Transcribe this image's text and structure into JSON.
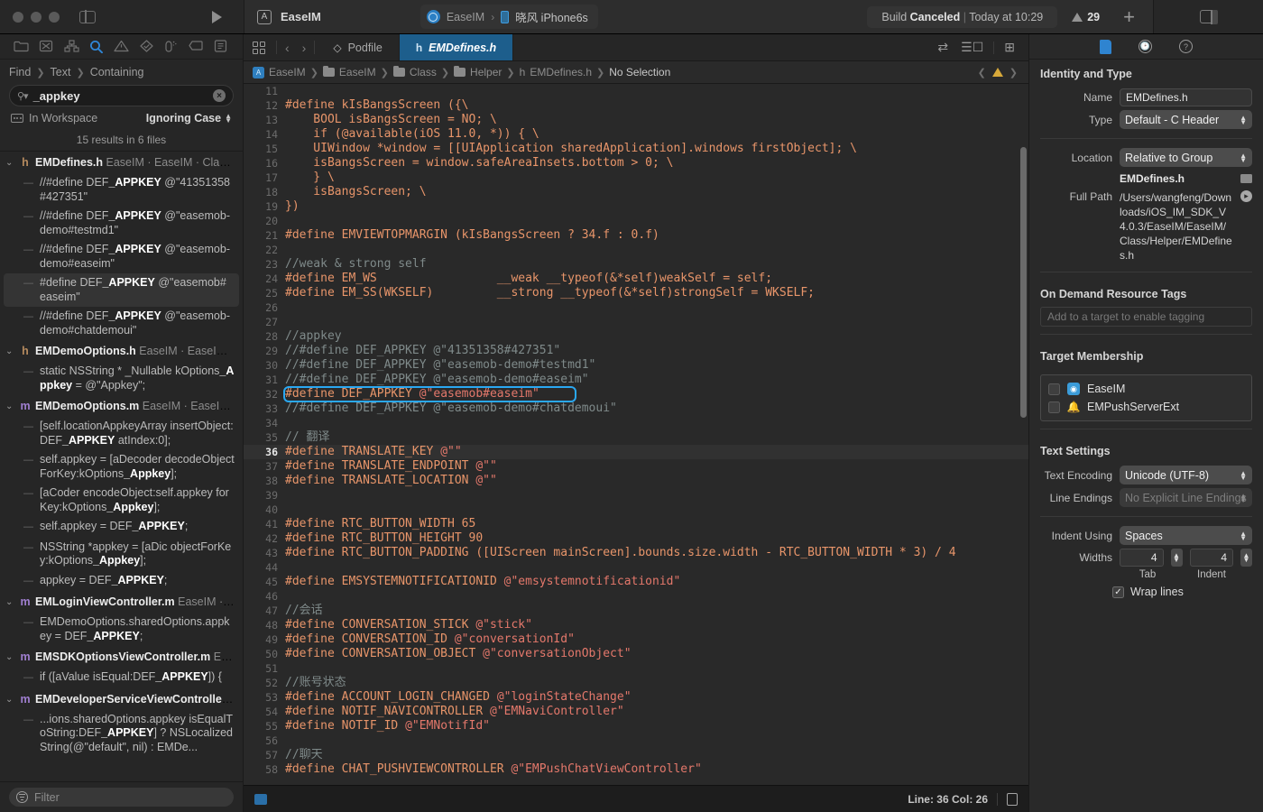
{
  "titlebar": {
    "project_name": "EaseIM",
    "scheme_name": "EaseIM",
    "device_name": "晓风 iPhone6s",
    "status_prefix": "Build ",
    "status_bold": "Canceled",
    "status_sep": " | ",
    "status_suffix": "Today at 10:29",
    "warning_count": "29",
    "add_label": "+",
    "icons": {
      "sidebar_toggle": "sidebar-toggle-icon",
      "run": "run-icon",
      "inspector_toggle": "inspector-toggle-icon"
    }
  },
  "navigator": {
    "icon_bar": [
      {
        "name": "folder-icon",
        "label": "Project navigator"
      },
      {
        "name": "source-control-icon",
        "label": "Source control navigator"
      },
      {
        "name": "symbol-icon",
        "label": "Symbol navigator"
      },
      {
        "name": "search-icon",
        "label": "Find navigator",
        "active": true
      },
      {
        "name": "warning-icon",
        "label": "Issue navigator"
      },
      {
        "name": "test-icon",
        "label": "Test navigator"
      },
      {
        "name": "debug-icon",
        "label": "Debug navigator"
      },
      {
        "name": "breakpoint-icon",
        "label": "Breakpoint navigator"
      },
      {
        "name": "report-icon",
        "label": "Report navigator"
      }
    ],
    "find_crumbs": [
      "Find",
      "Text",
      "Containing"
    ],
    "search": {
      "value": "_appkey",
      "placeholder": "",
      "clear_label": "×"
    },
    "scope_label": "In Workspace",
    "case_label": "Ignoring Case",
    "results_count": "15 results in 6 files",
    "filter_placeholder": "Filter",
    "groups": [
      {
        "type": "h",
        "file": "EMDefines.h",
        "path": "EaseIM · EaseIM · Class...",
        "matches": [
          {
            "pre": "//#define DEF",
            "hit": "_APPKEY",
            "post": " @\"41351358#427351\"",
            "selected": false
          },
          {
            "pre": "//#define DEF",
            "hit": "_APPKEY",
            "post": " @\"easemob-demo#testmd1\"",
            "selected": false
          },
          {
            "pre": "//#define DEF",
            "hit": "_APPKEY",
            "post": " @\"easemob-demo#easeim\"",
            "selected": false
          },
          {
            "pre": "#define DEF",
            "hit": "_APPKEY",
            "post": " @\"easemob#easeim\"",
            "selected": true
          },
          {
            "pre": "//#define DEF",
            "hit": "_APPKEY",
            "post": " @\"easemob-demo#chatdemoui\"",
            "selected": false
          }
        ]
      },
      {
        "type": "h",
        "file": "EMDemoOptions.h",
        "path": "EaseIM · EaseIM ·...",
        "matches": [
          {
            "pre": "static NSString * _Nullable kOptions",
            "hit": "_Appkey",
            "post": " = @\"Appkey\";",
            "selected": false
          }
        ]
      },
      {
        "type": "m",
        "file": "EMDemoOptions.m",
        "path": "EaseIM · EaseIM...",
        "matches": [
          {
            "pre": "[self.locationAppkeyArray insertObject:DEF",
            "hit": "_APPKEY",
            "post": " atIndex:0];",
            "selected": false
          },
          {
            "pre": "self.appkey = [aDecoder decodeObjectForKey:kOptions",
            "hit": "_Appkey",
            "post": "];",
            "selected": false
          },
          {
            "pre": "[aCoder encodeObject:self.appkey forKey:kOptions",
            "hit": "_Appkey",
            "post": "];",
            "selected": false
          },
          {
            "pre": "self.appkey = DEF",
            "hit": "_APPKEY",
            "post": ";",
            "selected": false
          },
          {
            "pre": "NSString *appkey = [aDic objectForKey:kOptions",
            "hit": "_Appkey",
            "post": "];",
            "selected": false
          },
          {
            "pre": "appkey = DEF",
            "hit": "_APPKEY",
            "post": ";",
            "selected": false
          }
        ]
      },
      {
        "type": "m",
        "file": "EMLoginViewController.m",
        "path": "EaseIM · E...",
        "matches": [
          {
            "pre": "EMDemoOptions.sharedOptions.appkey = DEF",
            "hit": "_APPKEY",
            "post": ";",
            "selected": false
          }
        ]
      },
      {
        "type": "m",
        "file": "EMSDKOptionsViewController.m",
        "path": "Eas...",
        "matches": [
          {
            "pre": "if ([aValue isEqual:DEF",
            "hit": "_APPKEY",
            "post": "]) {",
            "selected": false
          }
        ]
      },
      {
        "type": "m",
        "file": "EMDeveloperServiceViewController....",
        "path": "",
        "matches": [
          {
            "pre": "...ions.sharedOptions.appkey isEqualToString:DEF",
            "hit": "_APPKEY",
            "post": "] ? NSLocalizedString(@\"default\", nil) : EMDe...",
            "selected": false
          }
        ]
      }
    ]
  },
  "editor": {
    "tabs": [
      {
        "label": "Podfile",
        "icon": "ruby-icon",
        "active": false
      },
      {
        "label": "EMDefines.h",
        "icon": "header-icon",
        "active": true
      }
    ],
    "jumpbar": [
      {
        "label": "EaseIM",
        "icon": "project-icon"
      },
      {
        "label": "EaseIM",
        "icon": "folder-icon"
      },
      {
        "label": "Class",
        "icon": "folder-icon"
      },
      {
        "label": "Helper",
        "icon": "folder-icon"
      },
      {
        "label": "EMDefines.h",
        "icon": "header-icon"
      },
      {
        "label": "No Selection",
        "icon": ""
      }
    ],
    "code": [
      {
        "n": 11,
        "tokens": []
      },
      {
        "n": 12,
        "tokens": [
          {
            "t": "#define kIsBangsScreen ({\\",
            "c": "macro"
          }
        ]
      },
      {
        "n": 13,
        "tokens": [
          {
            "t": "    BOOL isBangsScreen = NO; \\",
            "c": "macro"
          }
        ]
      },
      {
        "n": 14,
        "tokens": [
          {
            "t": "    if (@available(iOS 11.0, *)) { \\",
            "c": "macro"
          }
        ]
      },
      {
        "n": 15,
        "tokens": [
          {
            "t": "    UIWindow *window = [[UIApplication sharedApplication].windows firstObject]; \\",
            "c": "macro"
          }
        ]
      },
      {
        "n": 16,
        "tokens": [
          {
            "t": "    isBangsScreen = window.safeAreaInsets.bottom > 0; \\",
            "c": "macro"
          }
        ]
      },
      {
        "n": 17,
        "tokens": [
          {
            "t": "    } \\",
            "c": "macro"
          }
        ]
      },
      {
        "n": 18,
        "tokens": [
          {
            "t": "    isBangsScreen; \\",
            "c": "macro"
          }
        ]
      },
      {
        "n": 19,
        "tokens": [
          {
            "t": "})",
            "c": "macro"
          }
        ]
      },
      {
        "n": 20,
        "tokens": []
      },
      {
        "n": 21,
        "tokens": [
          {
            "t": "#define EMVIEWTOPMARGIN (kIsBangsScreen ? 34.f : 0.f)",
            "c": "macro"
          }
        ]
      },
      {
        "n": 22,
        "tokens": []
      },
      {
        "n": 23,
        "tokens": [
          {
            "t": "//weak & strong self",
            "c": "cmt"
          }
        ]
      },
      {
        "n": 24,
        "tokens": [
          {
            "t": "#define EM_WS                 __weak __typeof(&*self)weakSelf = self;",
            "c": "macro"
          }
        ]
      },
      {
        "n": 25,
        "tokens": [
          {
            "t": "#define EM_SS(WKSELF)         __strong __typeof(&*self)strongSelf = WKSELF;",
            "c": "macro"
          }
        ]
      },
      {
        "n": 26,
        "tokens": []
      },
      {
        "n": 27,
        "tokens": []
      },
      {
        "n": 28,
        "tokens": [
          {
            "t": "//appkey",
            "c": "cmt"
          }
        ]
      },
      {
        "n": 29,
        "tokens": [
          {
            "t": "//#define DEF_APPKEY @\"41351358#427351\"",
            "c": "cmt"
          }
        ]
      },
      {
        "n": 30,
        "tokens": [
          {
            "t": "//#define DEF_APPKEY @\"easemob-demo#testmd1\"",
            "c": "cmt"
          }
        ]
      },
      {
        "n": 31,
        "tokens": [
          {
            "t": "//#define DEF_APPKEY @\"easemob-demo#easeim\"",
            "c": "cmt"
          }
        ]
      },
      {
        "n": 32,
        "tokens": [
          {
            "t": "#define DEF_APPKEY ",
            "c": "macro"
          },
          {
            "t": "@\"easemob#easeim\"",
            "c": "str"
          }
        ],
        "highlight": true
      },
      {
        "n": 33,
        "tokens": [
          {
            "t": "//#define DEF_APPKEY @\"easemob-demo#chatdemoui\"",
            "c": "cmt"
          }
        ]
      },
      {
        "n": 34,
        "tokens": []
      },
      {
        "n": 35,
        "tokens": [
          {
            "t": "// 翻译",
            "c": "cmt"
          }
        ]
      },
      {
        "n": 36,
        "tokens": [
          {
            "t": "#define TRANSLATE_KEY ",
            "c": "macro"
          },
          {
            "t": "@\"\"",
            "c": "str"
          }
        ],
        "current": true
      },
      {
        "n": 37,
        "tokens": [
          {
            "t": "#define TRANSLATE_ENDPOINT ",
            "c": "macro"
          },
          {
            "t": "@\"\"",
            "c": "str"
          }
        ]
      },
      {
        "n": 38,
        "tokens": [
          {
            "t": "#define TRANSLATE_LOCATION ",
            "c": "macro"
          },
          {
            "t": "@\"\"",
            "c": "str"
          }
        ]
      },
      {
        "n": 39,
        "tokens": []
      },
      {
        "n": 40,
        "tokens": []
      },
      {
        "n": 41,
        "tokens": [
          {
            "t": "#define RTC_BUTTON_WIDTH 65",
            "c": "macro"
          }
        ]
      },
      {
        "n": 42,
        "tokens": [
          {
            "t": "#define RTC_BUTTON_HEIGHT 90",
            "c": "macro"
          }
        ]
      },
      {
        "n": 43,
        "tokens": [
          {
            "t": "#define RTC_BUTTON_PADDING ([UIScreen mainScreen].bounds.size.width - RTC_BUTTON_WIDTH * 3) / 4",
            "c": "macro"
          }
        ]
      },
      {
        "n": 44,
        "tokens": []
      },
      {
        "n": 45,
        "tokens": [
          {
            "t": "#define EMSYSTEMNOTIFICATIONID ",
            "c": "macro"
          },
          {
            "t": "@\"emsystemnotificationid\"",
            "c": "str"
          }
        ]
      },
      {
        "n": 46,
        "tokens": []
      },
      {
        "n": 47,
        "tokens": [
          {
            "t": "//会话",
            "c": "cmt"
          }
        ]
      },
      {
        "n": 48,
        "tokens": [
          {
            "t": "#define CONVERSATION_STICK ",
            "c": "macro"
          },
          {
            "t": "@\"stick\"",
            "c": "str"
          }
        ]
      },
      {
        "n": 49,
        "tokens": [
          {
            "t": "#define CONVERSATION_ID ",
            "c": "macro"
          },
          {
            "t": "@\"conversationId\"",
            "c": "str"
          }
        ]
      },
      {
        "n": 50,
        "tokens": [
          {
            "t": "#define CONVERSATION_OBJECT ",
            "c": "macro"
          },
          {
            "t": "@\"conversationObject\"",
            "c": "str"
          }
        ]
      },
      {
        "n": 51,
        "tokens": []
      },
      {
        "n": 52,
        "tokens": [
          {
            "t": "//账号状态",
            "c": "cmt"
          }
        ]
      },
      {
        "n": 53,
        "tokens": [
          {
            "t": "#define ACCOUNT_LOGIN_CHANGED ",
            "c": "macro"
          },
          {
            "t": "@\"loginStateChange\"",
            "c": "str"
          }
        ]
      },
      {
        "n": 54,
        "tokens": [
          {
            "t": "#define NOTIF_NAVICONTROLLER ",
            "c": "macro"
          },
          {
            "t": "@\"EMNaviController\"",
            "c": "str"
          }
        ]
      },
      {
        "n": 55,
        "tokens": [
          {
            "t": "#define NOTIF_ID ",
            "c": "macro"
          },
          {
            "t": "@\"EMNotifId\"",
            "c": "str"
          }
        ]
      },
      {
        "n": 56,
        "tokens": []
      },
      {
        "n": 57,
        "tokens": [
          {
            "t": "//聊天",
            "c": "cmt"
          }
        ]
      },
      {
        "n": 58,
        "tokens": [
          {
            "t": "#define CHAT_PUSHVIEWCONTROLLER ",
            "c": "macro"
          },
          {
            "t": "@\"EMPushChatViewController\"",
            "c": "str"
          }
        ]
      }
    ]
  },
  "statusbar": {
    "line_col": "Line: 36  Col: 26"
  },
  "inspector": {
    "tabs": [
      {
        "name": "file-inspector-icon",
        "active": true
      },
      {
        "name": "history-inspector-icon",
        "active": false
      },
      {
        "name": "help-inspector-icon",
        "active": false
      }
    ],
    "identity_title": "Identity and Type",
    "name_label": "Name",
    "name_value": "EMDefines.h",
    "type_label": "Type",
    "type_value": "Default - C Header",
    "location_label": "Location",
    "location_value": "Relative to Group",
    "location_file": "EMDefines.h",
    "fullpath_label": "Full Path",
    "fullpath_value": "/Users/wangfeng/Downloads/iOS_IM_SDK_V4.0.3/EaseIM/EaseIM/Class/Helper/EMDefines.h",
    "odr_title": "On Demand Resource Tags",
    "odr_placeholder": "Add to a target to enable tagging",
    "target_title": "Target Membership",
    "targets": [
      {
        "name": "EaseIM",
        "checked": false,
        "icon": "app-icon"
      },
      {
        "name": "EMPushServerExt",
        "checked": false,
        "icon": "extension-icon"
      }
    ],
    "text_title": "Text Settings",
    "encoding_label": "Text Encoding",
    "encoding_value": "Unicode (UTF-8)",
    "endings_label": "Line Endings",
    "endings_value": "No Explicit Line Endings",
    "indent_label": "Indent Using",
    "indent_value": "Spaces",
    "widths_label": "Widths",
    "tab_width": "4",
    "indent_width": "4",
    "tab_caption": "Tab",
    "indent_caption": "Indent",
    "wrap_label": "Wrap lines",
    "wrap_checked": true,
    "check_glyph": "✓"
  },
  "colors": {
    "accent_blue": "#2aa8f2",
    "tab_active": "#1d5e8c",
    "macro_orange": "#e8956a",
    "string_red": "#e4786b",
    "comment_gray": "#7f8a8a",
    "warning_yellow": "#d8a93a"
  }
}
